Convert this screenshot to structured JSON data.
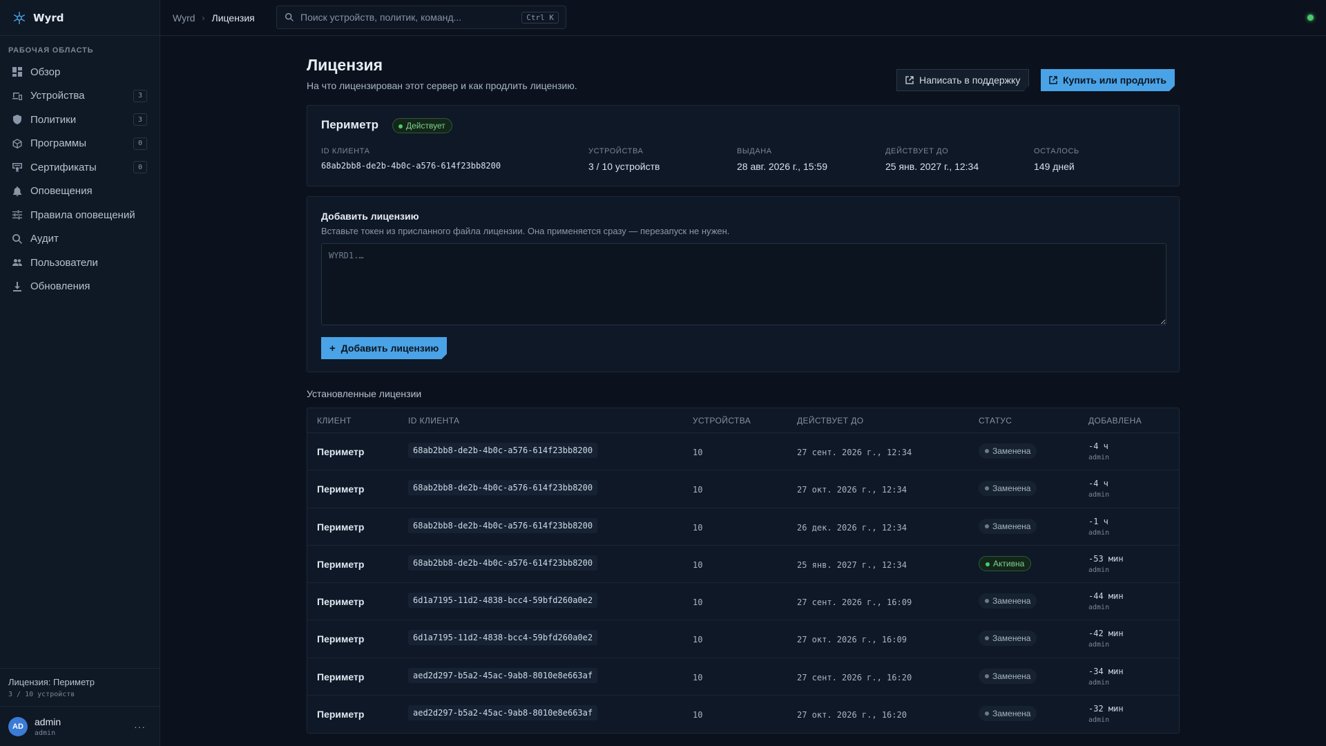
{
  "app": {
    "name": "Wyrd"
  },
  "sidebar": {
    "section_title": "РАБОЧАЯ ОБЛАСТЬ",
    "items": [
      {
        "label": "Обзор",
        "icon": "grid-icon",
        "badge": null
      },
      {
        "label": "Устройства",
        "icon": "devices-icon",
        "badge": "3"
      },
      {
        "label": "Политики",
        "icon": "shield-icon",
        "badge": "3"
      },
      {
        "label": "Программы",
        "icon": "package-icon",
        "badge": "0"
      },
      {
        "label": "Сертификаты",
        "icon": "certificate-icon",
        "badge": "0"
      },
      {
        "label": "Оповещения",
        "icon": "bell-icon",
        "badge": null
      },
      {
        "label": "Правила оповещений",
        "icon": "sliders-icon",
        "badge": null
      },
      {
        "label": "Аудит",
        "icon": "search-icon",
        "badge": null
      },
      {
        "label": "Пользователи",
        "icon": "users-icon",
        "badge": null
      },
      {
        "label": "Обновления",
        "icon": "download-icon",
        "badge": null
      }
    ],
    "license_title": "Лицензия: Периметр",
    "license_usage": "3 / 10 устройств",
    "user": {
      "initials": "AD",
      "name": "admin",
      "role": "admin",
      "more": "···"
    }
  },
  "topbar": {
    "breadcrumb_root": "Wyrd",
    "breadcrumb_current": "Лицензия",
    "search_placeholder": "Поиск устройств, политик, команд...",
    "search_shortcut": "Ctrl K",
    "status_color": "#4cc96a"
  },
  "page": {
    "title": "Лицензия",
    "subtitle": "На что лицензирован этот сервер и как продлить лицензию.",
    "support_button": "Написать в поддержку",
    "buy_button": "Купить или продлить"
  },
  "current_license": {
    "name": "Периметр",
    "status": "Действует",
    "fields": {
      "client_id_label": "ID КЛИЕНТА",
      "client_id": "68ab2bb8-de2b-4b0c-a576-614f23bb8200",
      "devices_label": "УСТРОЙСТВА",
      "devices": "3 / 10 устройств",
      "issued_label": "ВЫДАНА",
      "issued": "28 авг. 2026 г., 15:59",
      "valid_until_label": "ДЕЙСТВУЕТ ДО",
      "valid_until": "25 янв. 2027 г., 12:34",
      "remaining_label": "ОСТАЛОСЬ",
      "remaining": "149 дней"
    }
  },
  "add_license": {
    "title": "Добавить лицензию",
    "description": "Вставьте токен из присланного файла лицензии. Она применяется сразу — перезапуск не нужен.",
    "placeholder": "WYRD1.…",
    "button": "Добавить лицензию",
    "button_icon": "+"
  },
  "installed": {
    "title": "Установленные лицензии",
    "columns": {
      "client": "КЛИЕНТ",
      "client_id": "ID КЛИЕНТА",
      "devices": "УСТРОЙСТВА",
      "valid_until": "ДЕЙСТВУЕТ ДО",
      "status": "СТАТУС",
      "added": "ДОБАВЛЕНА"
    },
    "rows": [
      {
        "client": "Периметр",
        "client_id": "68ab2bb8-de2b-4b0c-a576-614f23bb8200",
        "devices": "10",
        "valid_until": "27 сент. 2026 г., 12:34",
        "status": "Заменена",
        "active": false,
        "added": "-4 ч",
        "added_by": "admin"
      },
      {
        "client": "Периметр",
        "client_id": "68ab2bb8-de2b-4b0c-a576-614f23bb8200",
        "devices": "10",
        "valid_until": "27 окт. 2026 г., 12:34",
        "status": "Заменена",
        "active": false,
        "added": "-4 ч",
        "added_by": "admin"
      },
      {
        "client": "Периметр",
        "client_id": "68ab2bb8-de2b-4b0c-a576-614f23bb8200",
        "devices": "10",
        "valid_until": "26 дек. 2026 г., 12:34",
        "status": "Заменена",
        "active": false,
        "added": "-1 ч",
        "added_by": "admin"
      },
      {
        "client": "Периметр",
        "client_id": "68ab2bb8-de2b-4b0c-a576-614f23bb8200",
        "devices": "10",
        "valid_until": "25 янв. 2027 г., 12:34",
        "status": "Активна",
        "active": true,
        "added": "-53 мин",
        "added_by": "admin"
      },
      {
        "client": "Периметр",
        "client_id": "6d1a7195-11d2-4838-bcc4-59bfd260a0e2",
        "devices": "10",
        "valid_until": "27 сент. 2026 г., 16:09",
        "status": "Заменена",
        "active": false,
        "added": "-44 мин",
        "added_by": "admin"
      },
      {
        "client": "Периметр",
        "client_id": "6d1a7195-11d2-4838-bcc4-59bfd260a0e2",
        "devices": "10",
        "valid_until": "27 окт. 2026 г., 16:09",
        "status": "Заменена",
        "active": false,
        "added": "-42 мин",
        "added_by": "admin"
      },
      {
        "client": "Периметр",
        "client_id": "aed2d297-b5a2-45ac-9ab8-8010e8e663af",
        "devices": "10",
        "valid_until": "27 сент. 2026 г., 16:20",
        "status": "Заменена",
        "active": false,
        "added": "-34 мин",
        "added_by": "admin"
      },
      {
        "client": "Периметр",
        "client_id": "aed2d297-b5a2-45ac-9ab8-8010e8e663af",
        "devices": "10",
        "valid_until": "27 окт. 2026 г., 16:20",
        "status": "Заменена",
        "active": false,
        "added": "-32 мин",
        "added_by": "admin"
      }
    ]
  },
  "colors": {
    "accent": "#4aa3e6",
    "success": "#4cc96a",
    "background": "#0b121d"
  }
}
